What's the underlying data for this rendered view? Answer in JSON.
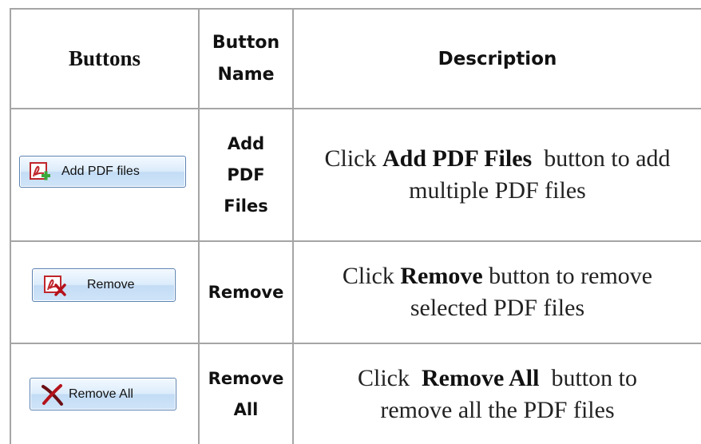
{
  "table": {
    "headers": {
      "buttons": "Buttons",
      "button_name_line1": "Button",
      "button_name_line2": "Name",
      "description": "Description"
    },
    "rows": [
      {
        "button_label": "Add PDF files",
        "icon": "add-pdf-icon",
        "name_lines": [
          "Add",
          "PDF",
          "Files"
        ],
        "desc_prefix": "Click ",
        "desc_bold": "Add PDF Files",
        "desc_suffix": "  button to add multiple PDF files"
      },
      {
        "button_label": "Remove",
        "icon": "remove-pdf-icon",
        "name_lines": [
          "Remove"
        ],
        "desc_prefix": "Click ",
        "desc_bold": "Remove",
        "desc_suffix": " button to remove selected PDF files"
      },
      {
        "button_label": "Remove All",
        "icon": "remove-all-icon",
        "name_lines": [
          "Remove",
          "All"
        ],
        "desc_prefix": "Click  ",
        "desc_bold": "Remove All",
        "desc_suffix": "  button to remove all the PDF files"
      }
    ]
  },
  "colors": {
    "grid": "#a5a5a5",
    "button_border": "#5a82b2",
    "pdf_red": "#c0262c",
    "add_green": "#3aa83a"
  }
}
